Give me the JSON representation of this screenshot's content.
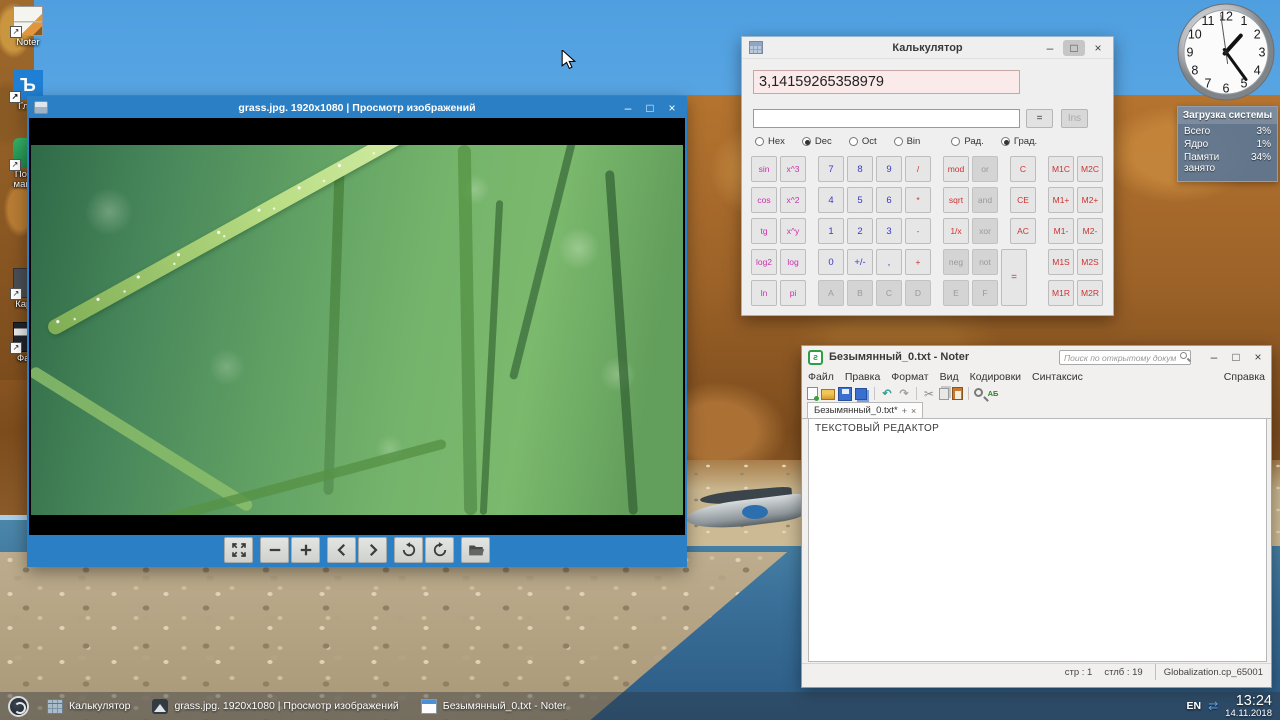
{
  "window_controls": {
    "minimize": "–",
    "maximize": "□",
    "close": "×"
  },
  "desktop": {
    "icons": [
      {
        "label": "Noter",
        "icon": "notepad"
      },
      {
        "label": "Гл…",
        "icon": "hard-sign",
        "glyph": "Ъ"
      },
      {
        "label": "Пос… маш…",
        "icon": "green-app"
      },
      {
        "label": "Кар…",
        "icon": "shortcut"
      },
      {
        "label": "Фа…",
        "icon": "dark-app"
      }
    ]
  },
  "viewer": {
    "title": "grass.jpg. 1920x1080 | Просмотр изображений",
    "toolbar_icons": [
      "fit-to-screen",
      "zoom-out",
      "zoom-in",
      "previous-image",
      "next-image",
      "rotate-left",
      "rotate-right",
      "open-file"
    ]
  },
  "calculator": {
    "title": "Калькулятор",
    "display": "3,14159265358979",
    "input": "",
    "equals_small": "=",
    "ins_label": "Ins",
    "equals_key": "=",
    "modes": [
      {
        "label": "Hex",
        "state": ""
      },
      {
        "label": "Dec",
        "state": "checked"
      },
      {
        "label": "Oct",
        "state": ""
      },
      {
        "label": "Bin",
        "state": ""
      },
      {
        "label": "Рад.",
        "state": ""
      },
      {
        "label": "Град.",
        "state": "checked"
      }
    ],
    "rows": [
      [
        {
          "t": "sin",
          "c": "fn"
        },
        {
          "t": "x^3",
          "c": "fn"
        },
        {
          "c": "sp"
        },
        {
          "t": "7",
          "c": "num"
        },
        {
          "t": "8",
          "c": "num"
        },
        {
          "t": "9",
          "c": "num"
        },
        {
          "t": "/",
          "c": "op"
        },
        {
          "c": "sp"
        },
        {
          "t": "mod",
          "c": "op"
        },
        {
          "t": "or",
          "c": "dis"
        },
        {
          "c": "sp"
        },
        {
          "t": "C",
          "c": "op"
        },
        {
          "c": "sp"
        },
        {
          "t": "M1C",
          "c": "op"
        },
        {
          "t": "M2C",
          "c": "op"
        }
      ],
      [
        {
          "t": "cos",
          "c": "fn"
        },
        {
          "t": "x^2",
          "c": "fn"
        },
        {
          "c": "sp"
        },
        {
          "t": "4",
          "c": "num"
        },
        {
          "t": "5",
          "c": "num"
        },
        {
          "t": "6",
          "c": "num"
        },
        {
          "t": "*",
          "c": "op"
        },
        {
          "c": "sp"
        },
        {
          "t": "sqrt",
          "c": "op"
        },
        {
          "t": "and",
          "c": "dis"
        },
        {
          "c": "sp"
        },
        {
          "t": "CE",
          "c": "op"
        },
        {
          "c": "sp"
        },
        {
          "t": "M1+",
          "c": "op"
        },
        {
          "t": "M2+",
          "c": "op"
        }
      ],
      [
        {
          "t": "tg",
          "c": "fn"
        },
        {
          "t": "x^y",
          "c": "fn"
        },
        {
          "c": "sp"
        },
        {
          "t": "1",
          "c": "num"
        },
        {
          "t": "2",
          "c": "num"
        },
        {
          "t": "3",
          "c": "num"
        },
        {
          "t": "-",
          "c": "op"
        },
        {
          "c": "sp"
        },
        {
          "t": "1/x",
          "c": "op"
        },
        {
          "t": "xor",
          "c": "dis"
        },
        {
          "c": "sp"
        },
        {
          "t": "AC",
          "c": "op"
        },
        {
          "c": "sp"
        },
        {
          "t": "M1-",
          "c": "op"
        },
        {
          "t": "M2-",
          "c": "op"
        }
      ],
      [
        {
          "t": "log2",
          "c": "fn"
        },
        {
          "t": "log",
          "c": "fn"
        },
        {
          "c": "sp"
        },
        {
          "t": "0",
          "c": "num"
        },
        {
          "t": "+/-",
          "c": "num"
        },
        {
          "t": ",",
          "c": "num"
        },
        {
          "t": "+",
          "c": "op"
        },
        {
          "c": "sp"
        },
        {
          "t": "neg",
          "c": "dis"
        },
        {
          "t": "not",
          "c": "dis"
        },
        {
          "c": "sp"
        },
        {
          "c": "ph"
        },
        {
          "c": "sp"
        },
        {
          "t": "M1S",
          "c": "op"
        },
        {
          "t": "M2S",
          "c": "op"
        }
      ],
      [
        {
          "t": "ln",
          "c": "fn"
        },
        {
          "t": "pi",
          "c": "fn"
        },
        {
          "c": "sp"
        },
        {
          "t": "A",
          "c": "dis"
        },
        {
          "t": "B",
          "c": "dis"
        },
        {
          "t": "C",
          "c": "dis"
        },
        {
          "t": "D",
          "c": "dis"
        },
        {
          "c": "sp"
        },
        {
          "t": "E",
          "c": "dis"
        },
        {
          "t": "F",
          "c": "dis"
        },
        {
          "c": "sp"
        },
        {
          "c": "ph"
        },
        {
          "c": "sp"
        },
        {
          "t": "M1R",
          "c": "op"
        },
        {
          "t": "M2R",
          "c": "op"
        }
      ]
    ]
  },
  "noter": {
    "title": "Безымянный_0.txt - Noter",
    "icon_glyph": "ƨ",
    "search_placeholder": "Поиск по открытому документу",
    "menus": [
      "Файл",
      "Правка",
      "Формат",
      "Вид",
      "Кодировки",
      "Синтаксис"
    ],
    "help_menu": "Справка",
    "toolbar_icons": [
      "new-file",
      "open-file",
      "save-file",
      "save-all",
      "undo",
      "redo",
      "cut",
      "copy",
      "paste",
      "find",
      "encoding"
    ],
    "tab": {
      "title": "Безымянный_0.txt*",
      "pin": "+",
      "close": "×"
    },
    "content": "ТЕКСТОВЫЙ РЕДАКТОР",
    "status": {
      "line": "стр : 1",
      "column": "стлб : 19",
      "encoding": "Globalization.cp_65001"
    }
  },
  "widgets": {
    "clock": {
      "time": "13:24",
      "numbers": [
        "1",
        "2",
        "3",
        "4",
        "5",
        "6",
        "7",
        "8",
        "9",
        "10",
        "11",
        "12"
      ]
    },
    "sysload": {
      "title": "Загрузка системы",
      "rows": [
        {
          "label": "Всего",
          "value": "3%"
        },
        {
          "label": "Ядро",
          "value": "1%"
        },
        {
          "label": "Памяти занято",
          "value": "34%"
        }
      ]
    }
  },
  "taskbar": {
    "items": [
      {
        "icon": "calculator",
        "label": "Калькулятор"
      },
      {
        "icon": "image-viewer",
        "label": "grass.jpg. 1920x1080 | Просмотр изображений"
      },
      {
        "icon": "text-editor",
        "label": "Безымянный_0.txt - Noter"
      }
    ],
    "language": "EN",
    "network_glyph": "⇄",
    "time": "13:24",
    "date": "14.11.2018"
  },
  "colors": {
    "viewer_blue": "#2b7fc4",
    "calc_fn": "#cc2fae",
    "calc_num": "#3a3ac8",
    "calc_op": "#cc3333",
    "display_bg": "#fbeaea"
  }
}
